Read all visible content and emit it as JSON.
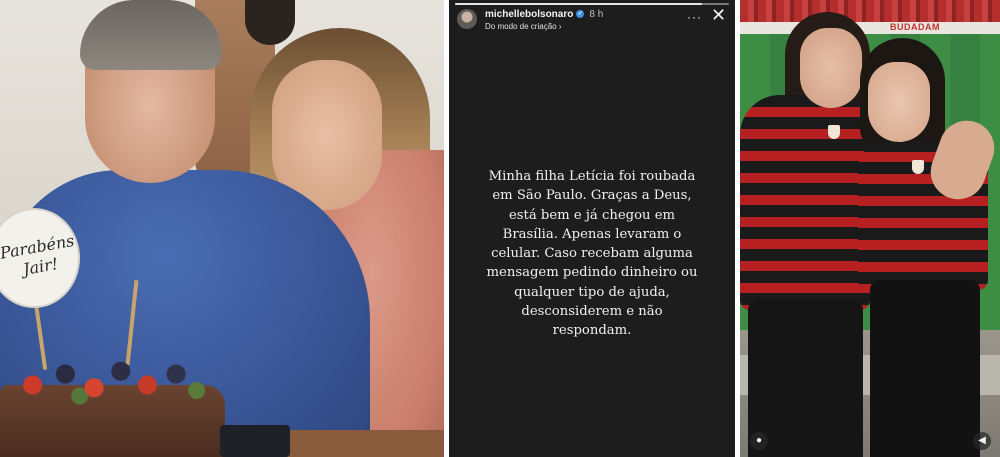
{
  "left_photo": {
    "sign_text": "Parabéns Jair!"
  },
  "story": {
    "username": "michellebolsonaro",
    "verified_badge": "✓",
    "timestamp": "8 h",
    "subtitle": "Do modo de criação ›",
    "more_icon": "···",
    "close_icon": "✕",
    "progress": 0.9,
    "message_lines": [
      "Minha filha Letícia foi roubada",
      "em São Paulo. Graças a Deus,",
      "está bem e já chegou em",
      "Brasília. Apenas levaram o",
      "celular. Caso recebam alguma",
      "mensagem pedindo dinheiro ou",
      "qualquer tipo de ajuda,",
      "desconsiderem e não",
      "respondam."
    ]
  },
  "right_photo": {
    "banner_text": "BUDADAM",
    "user_icon": "●",
    "mute_icon": "◀"
  },
  "colors": {
    "story_background": "#1d1d1d",
    "verified_blue": "#3d8fe8",
    "jersey_red": "#b62020",
    "jersey_black": "#1a1a1a"
  }
}
